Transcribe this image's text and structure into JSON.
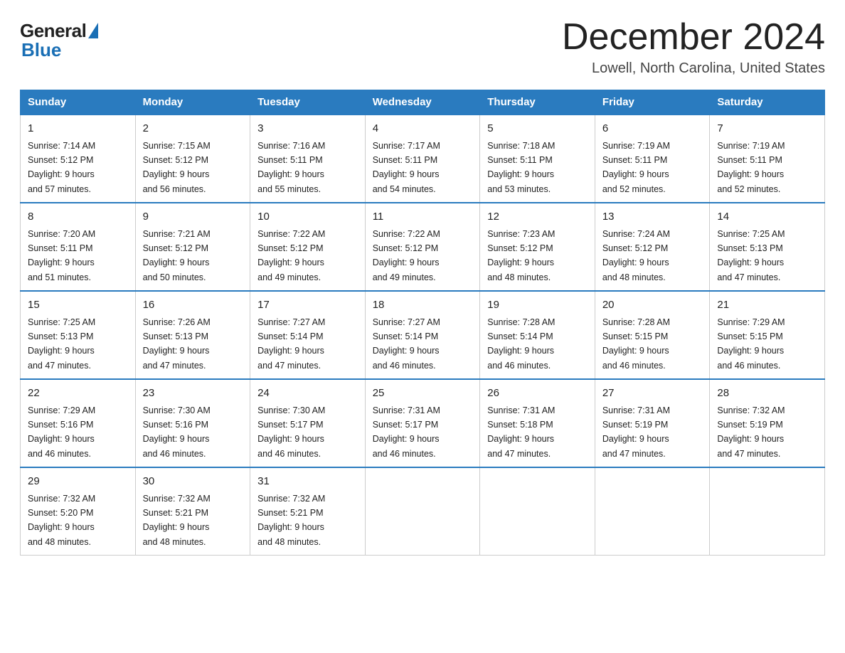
{
  "header": {
    "logo_general": "General",
    "logo_blue": "Blue",
    "title": "December 2024",
    "location": "Lowell, North Carolina, United States"
  },
  "days_of_week": [
    "Sunday",
    "Monday",
    "Tuesday",
    "Wednesday",
    "Thursday",
    "Friday",
    "Saturday"
  ],
  "weeks": [
    [
      {
        "day": "1",
        "sunrise": "7:14 AM",
        "sunset": "5:12 PM",
        "daylight": "9 hours and 57 minutes."
      },
      {
        "day": "2",
        "sunrise": "7:15 AM",
        "sunset": "5:12 PM",
        "daylight": "9 hours and 56 minutes."
      },
      {
        "day": "3",
        "sunrise": "7:16 AM",
        "sunset": "5:11 PM",
        "daylight": "9 hours and 55 minutes."
      },
      {
        "day": "4",
        "sunrise": "7:17 AM",
        "sunset": "5:11 PM",
        "daylight": "9 hours and 54 minutes."
      },
      {
        "day": "5",
        "sunrise": "7:18 AM",
        "sunset": "5:11 PM",
        "daylight": "9 hours and 53 minutes."
      },
      {
        "day": "6",
        "sunrise": "7:19 AM",
        "sunset": "5:11 PM",
        "daylight": "9 hours and 52 minutes."
      },
      {
        "day": "7",
        "sunrise": "7:19 AM",
        "sunset": "5:11 PM",
        "daylight": "9 hours and 52 minutes."
      }
    ],
    [
      {
        "day": "8",
        "sunrise": "7:20 AM",
        "sunset": "5:11 PM",
        "daylight": "9 hours and 51 minutes."
      },
      {
        "day": "9",
        "sunrise": "7:21 AM",
        "sunset": "5:12 PM",
        "daylight": "9 hours and 50 minutes."
      },
      {
        "day": "10",
        "sunrise": "7:22 AM",
        "sunset": "5:12 PM",
        "daylight": "9 hours and 49 minutes."
      },
      {
        "day": "11",
        "sunrise": "7:22 AM",
        "sunset": "5:12 PM",
        "daylight": "9 hours and 49 minutes."
      },
      {
        "day": "12",
        "sunrise": "7:23 AM",
        "sunset": "5:12 PM",
        "daylight": "9 hours and 48 minutes."
      },
      {
        "day": "13",
        "sunrise": "7:24 AM",
        "sunset": "5:12 PM",
        "daylight": "9 hours and 48 minutes."
      },
      {
        "day": "14",
        "sunrise": "7:25 AM",
        "sunset": "5:13 PM",
        "daylight": "9 hours and 47 minutes."
      }
    ],
    [
      {
        "day": "15",
        "sunrise": "7:25 AM",
        "sunset": "5:13 PM",
        "daylight": "9 hours and 47 minutes."
      },
      {
        "day": "16",
        "sunrise": "7:26 AM",
        "sunset": "5:13 PM",
        "daylight": "9 hours and 47 minutes."
      },
      {
        "day": "17",
        "sunrise": "7:27 AM",
        "sunset": "5:14 PM",
        "daylight": "9 hours and 47 minutes."
      },
      {
        "day": "18",
        "sunrise": "7:27 AM",
        "sunset": "5:14 PM",
        "daylight": "9 hours and 46 minutes."
      },
      {
        "day": "19",
        "sunrise": "7:28 AM",
        "sunset": "5:14 PM",
        "daylight": "9 hours and 46 minutes."
      },
      {
        "day": "20",
        "sunrise": "7:28 AM",
        "sunset": "5:15 PM",
        "daylight": "9 hours and 46 minutes."
      },
      {
        "day": "21",
        "sunrise": "7:29 AM",
        "sunset": "5:15 PM",
        "daylight": "9 hours and 46 minutes."
      }
    ],
    [
      {
        "day": "22",
        "sunrise": "7:29 AM",
        "sunset": "5:16 PM",
        "daylight": "9 hours and 46 minutes."
      },
      {
        "day": "23",
        "sunrise": "7:30 AM",
        "sunset": "5:16 PM",
        "daylight": "9 hours and 46 minutes."
      },
      {
        "day": "24",
        "sunrise": "7:30 AM",
        "sunset": "5:17 PM",
        "daylight": "9 hours and 46 minutes."
      },
      {
        "day": "25",
        "sunrise": "7:31 AM",
        "sunset": "5:17 PM",
        "daylight": "9 hours and 46 minutes."
      },
      {
        "day": "26",
        "sunrise": "7:31 AM",
        "sunset": "5:18 PM",
        "daylight": "9 hours and 47 minutes."
      },
      {
        "day": "27",
        "sunrise": "7:31 AM",
        "sunset": "5:19 PM",
        "daylight": "9 hours and 47 minutes."
      },
      {
        "day": "28",
        "sunrise": "7:32 AM",
        "sunset": "5:19 PM",
        "daylight": "9 hours and 47 minutes."
      }
    ],
    [
      {
        "day": "29",
        "sunrise": "7:32 AM",
        "sunset": "5:20 PM",
        "daylight": "9 hours and 48 minutes."
      },
      {
        "day": "30",
        "sunrise": "7:32 AM",
        "sunset": "5:21 PM",
        "daylight": "9 hours and 48 minutes."
      },
      {
        "day": "31",
        "sunrise": "7:32 AM",
        "sunset": "5:21 PM",
        "daylight": "9 hours and 48 minutes."
      },
      null,
      null,
      null,
      null
    ]
  ],
  "labels": {
    "sunrise": "Sunrise:",
    "sunset": "Sunset:",
    "daylight": "Daylight:"
  }
}
